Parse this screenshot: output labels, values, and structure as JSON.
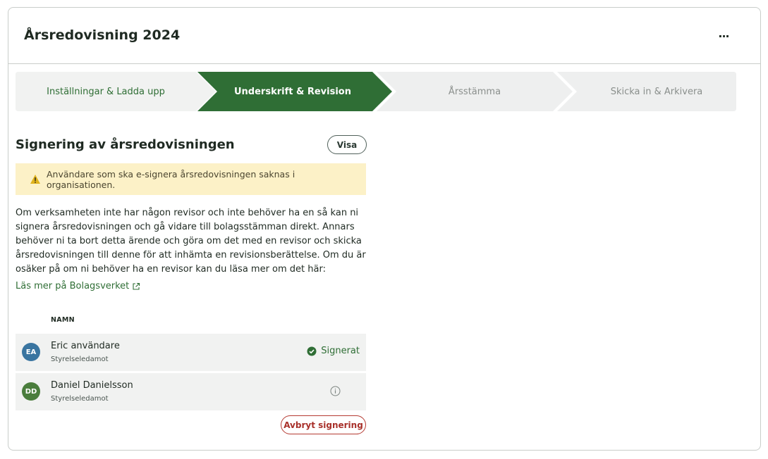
{
  "header": {
    "title": "Årsredovisning 2024",
    "more_label": "···"
  },
  "stepper": {
    "steps": [
      {
        "label": "Inställningar & Ladda upp",
        "state": "completed"
      },
      {
        "label": "Underskrift & Revision",
        "state": "active"
      },
      {
        "label": "Årsstämma",
        "state": "upcoming"
      },
      {
        "label": "Skicka in & Arkivera",
        "state": "upcoming"
      }
    ]
  },
  "signing": {
    "title": "Signering av årsredovisningen",
    "show_button": "Visa",
    "warning": "Användare som ska e-signera årsredovisningen saknas i organisationen.",
    "description": "Om verksamheten inte har någon revisor och inte behöver ha en så kan ni signera årsredovisningen och gå vidare till bolagsstämman direkt. Annars behöver ni ta bort detta ärende och göra om det med en revisor och skicka årsredovisningen till denne för att inhämta en revisionsberättelse. Om du är osäker på om ni behöver ha en revisor kan du läsa mer om det här:",
    "link": "Läs mer på Bolagsverket",
    "column_name": "NAMN",
    "signers": [
      {
        "initials": "EA",
        "name": "Eric användare",
        "role": "Styrelseledamot",
        "status": "Signerat"
      },
      {
        "initials": "DD",
        "name": "Daniel Danielsson",
        "role": "Styrelseledamot",
        "status": ""
      }
    ],
    "abort_button": "Avbryt signering"
  },
  "colors": {
    "active_step": "#2f6e35",
    "completed_step_bg": "#f1f2f1",
    "upcoming_step_bg": "#eeefef",
    "warning_bg": "#fcf1c7",
    "link": "#2f6e35",
    "danger": "#b53a32",
    "avatar_ea": "#3a75a0",
    "avatar_dd": "#4a7d3c"
  },
  "icons": {
    "more": "ellipsis-icon",
    "warning": "warning-triangle-icon",
    "external": "external-link-icon",
    "signed": "check-circle-icon",
    "info": "info-circle-icon"
  }
}
